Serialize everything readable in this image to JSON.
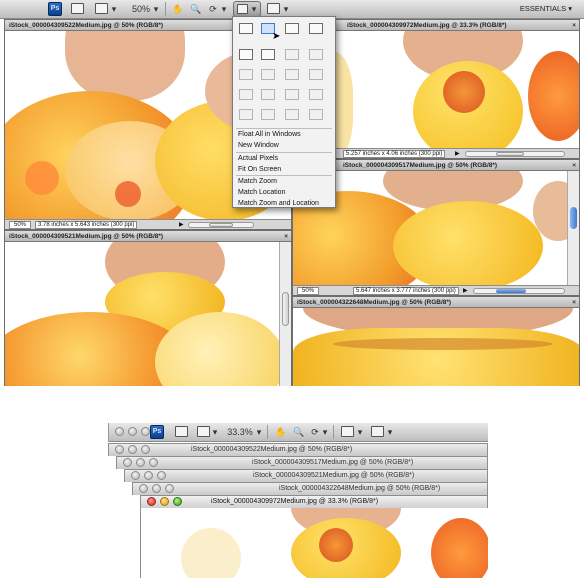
{
  "top_toolbar": {
    "app_logo": "Ps",
    "zoom": "50%",
    "workspace": "ESSENTIALS"
  },
  "top_docs": [
    {
      "tab": "iStock_000004309522Medium.jpg @ 50% (RGB/8*)",
      "zoom": "50%",
      "info": "3.78 inches x 5.643 inches (300 ppi)"
    },
    {
      "tab": "iStock_000004309972Medium.jpg @ 33.3% (RGB/8*)",
      "zoom": "",
      "info": "5.257 inches x 4.06 inches (300 ppi)"
    },
    {
      "tab": "iStock_000004309517Medium.jpg @ 50% (RGB/8*)",
      "zoom": "50%",
      "info": "5.647 inches x 3.777 inches (300 ppi)"
    },
    {
      "tab": "iStock_000004309521Medium.jpg @ 50% (RGB/8*)",
      "zoom": "",
      "info": ""
    },
    {
      "tab": "iStock_000004322648Medium.jpg @ 50% (RGB/8*)",
      "zoom": "",
      "info": ""
    }
  ],
  "arrange_menu": {
    "items": [
      "Float All in Windows",
      "New Window",
      "Actual Pixels",
      "Fit On Screen",
      "Match Zoom",
      "Match Location",
      "Match Zoom and Location"
    ]
  },
  "bottom_toolbar": {
    "app_logo": "Ps",
    "zoom": "33.3%"
  },
  "stacked_windows": [
    "iStock_000004309522Medium.jpg @ 50% (RGB/8*)",
    "iStock_000004309517Medium.jpg @ 50% (RGB/8*)",
    "iStock_000004309521Medium.jpg @ 50% (RGB/8*)",
    "iStock_000004322648Medium.jpg @ 50% (RGB/8*)",
    "iStock_000004309972Medium.jpg @ 33.3% (RGB/8*)"
  ],
  "colors": {
    "accent": "#3a7bd5",
    "costume_yellow": "#f2c21a",
    "costume_orange": "#e8832a"
  }
}
